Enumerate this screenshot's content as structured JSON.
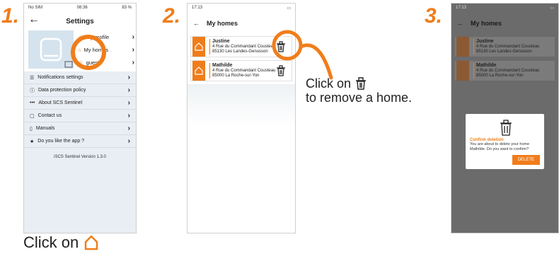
{
  "steps": [
    "1.",
    "2.",
    "3."
  ],
  "phone1": {
    "status": {
      "carrier": "No SIM",
      "time": "08:36",
      "battery": "83 %"
    },
    "title": "Settings",
    "back_glyph": "←",
    "top_menu": [
      "My profile",
      "My homes",
      "guests"
    ],
    "rows": [
      {
        "icon": "sliders-icon",
        "label": "Notifications settings"
      },
      {
        "icon": "info-icon",
        "label": "Data protection policy"
      },
      {
        "icon": "dots-icon",
        "label": "About SCS Sentinel"
      },
      {
        "icon": "chat-icon",
        "label": "Contact us"
      },
      {
        "icon": "doc-icon",
        "label": "Manuals"
      },
      {
        "icon": "star-icon",
        "label": "Do you like the app ?"
      }
    ],
    "version": "iSCS Sentinel Version 1.3.0"
  },
  "caption1": "Click on",
  "phone2": {
    "status": {
      "time": "17:13"
    },
    "title": "My homes",
    "homes": [
      {
        "name": "Justine",
        "addr1": "4 Rue du Commandant Cousteau",
        "addr2": "85130 Les Landes-Genusson"
      },
      {
        "name": "Mathilde",
        "addr1": "4 Rue du Commandant Cousteau",
        "addr2": "85000 La Roche-sur-Yon"
      }
    ]
  },
  "caption2": {
    "line1": "Click on",
    "line2": "to remove a home."
  },
  "phone3": {
    "status": {
      "time": "17:13"
    },
    "title": "My homes",
    "homes": [
      {
        "name": "Justine",
        "addr1": "4 Rue du Commandant Cousteau",
        "addr2": "85130 Les Landes-Genusson"
      },
      {
        "name": "Mathilde",
        "addr1": "4 Rue du Commandant Cousteau",
        "addr2": "85000 La Roche-sur-Yon"
      }
    ],
    "dialog": {
      "title": "Confirm deletion",
      "body": "You are about to delete your home Mathilde. Do you want to confirm?",
      "button": "DELETE"
    }
  }
}
